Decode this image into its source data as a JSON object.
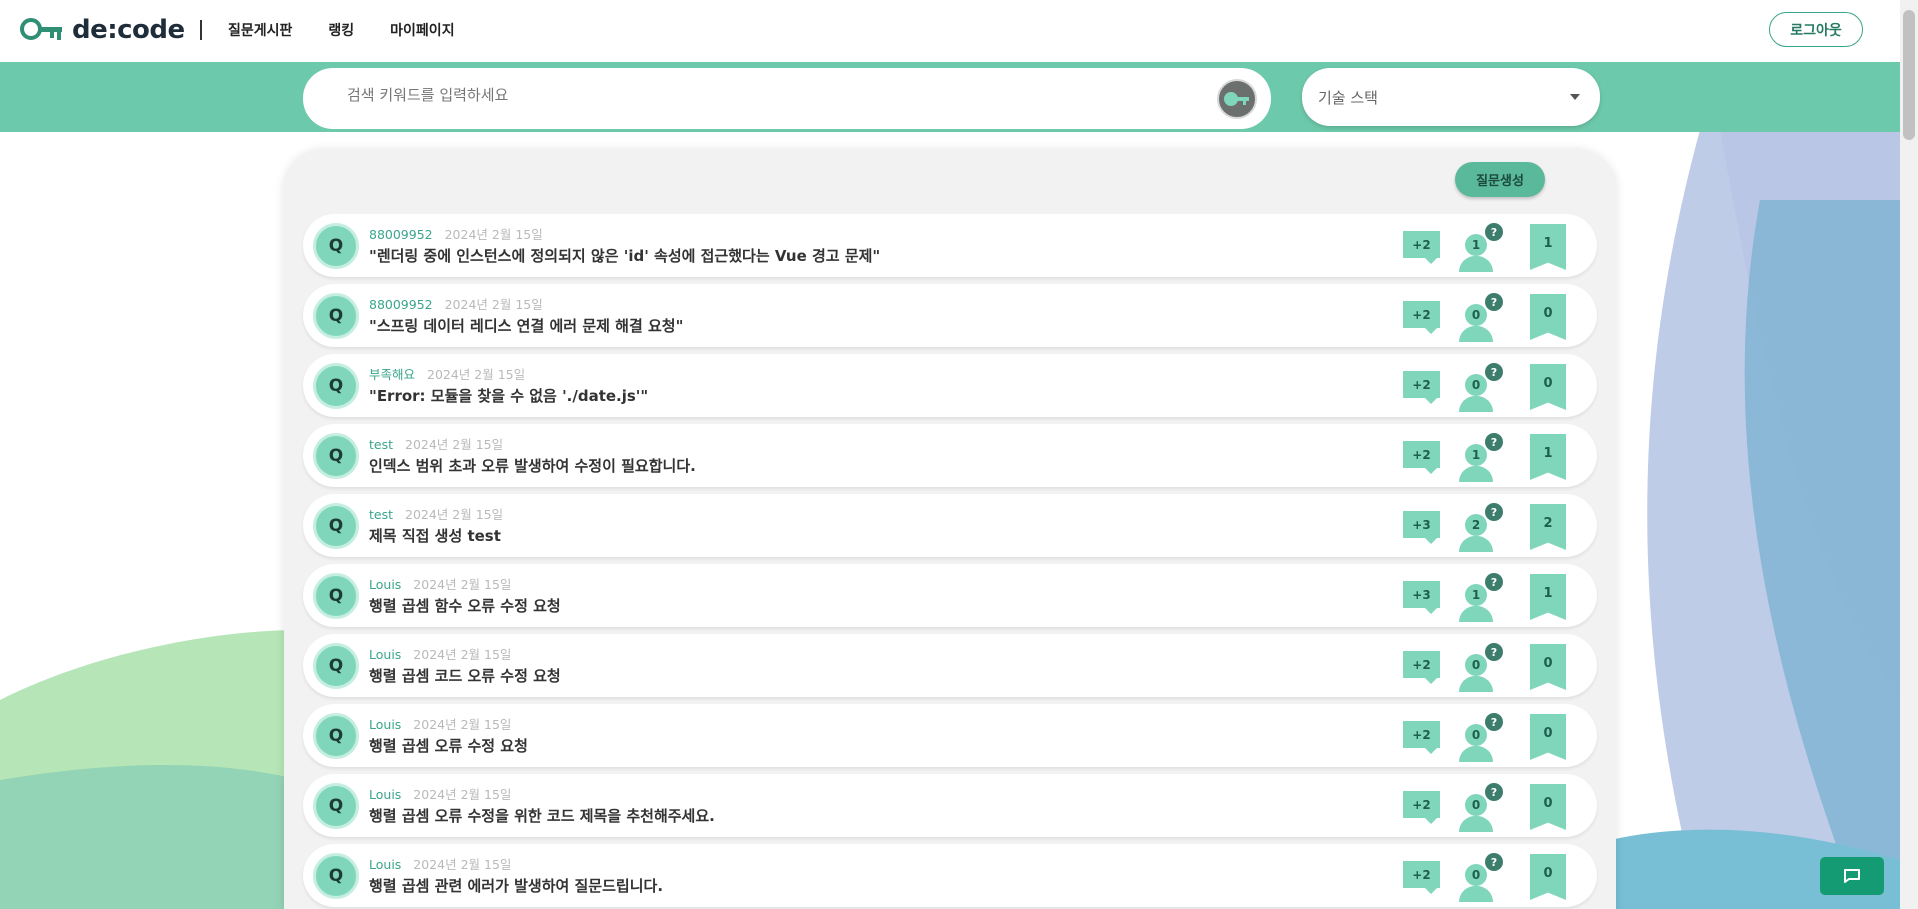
{
  "header": {
    "logo_text": "de:code",
    "nav": [
      "질문게시판",
      "랭킹",
      "마이페이지"
    ],
    "logout_label": "로그아웃"
  },
  "search": {
    "placeholder": "검색 키워드를 입력하세요",
    "tech_stack_label": "기술 스택"
  },
  "panel": {
    "create_label": "질문생성"
  },
  "questions": [
    {
      "avatar": "Q",
      "author": "88009952",
      "date": "2024년 2월 15일",
      "title": "\"렌더링 중에 인스턴스에 정의되지 않은 'id' 속성에 접근했다는 Vue 경고 문제\"",
      "points": "+2",
      "answers": "1",
      "bookmarks": "1"
    },
    {
      "avatar": "Q",
      "author": "88009952",
      "date": "2024년 2월 15일",
      "title": "\"스프링 데이터 레디스 연결 에러 문제 해결 요청\"",
      "points": "+2",
      "answers": "0",
      "bookmarks": "0"
    },
    {
      "avatar": "Q",
      "author": "부족해요",
      "date": "2024년 2월 15일",
      "title": "\"Error: 모듈을 찾을 수 없음 './date.js'\"",
      "points": "+2",
      "answers": "0",
      "bookmarks": "0"
    },
    {
      "avatar": "Q",
      "author": "test",
      "date": "2024년 2월 15일",
      "title": "인덱스 범위 초과 오류 발생하여 수정이 필요합니다.",
      "points": "+2",
      "answers": "1",
      "bookmarks": "1"
    },
    {
      "avatar": "Q",
      "author": "test",
      "date": "2024년 2월 15일",
      "title": "제목 직접 생성 test",
      "points": "+3",
      "answers": "2",
      "bookmarks": "2"
    },
    {
      "avatar": "Q",
      "author": "Louis",
      "date": "2024년 2월 15일",
      "title": "행렬 곱셈 함수 오류 수정 요청",
      "points": "+3",
      "answers": "1",
      "bookmarks": "1"
    },
    {
      "avatar": "Q",
      "author": "Louis",
      "date": "2024년 2월 15일",
      "title": "행렬 곱셈 코드 오류 수정 요청",
      "points": "+2",
      "answers": "0",
      "bookmarks": "0"
    },
    {
      "avatar": "Q",
      "author": "Louis",
      "date": "2024년 2월 15일",
      "title": "행렬 곱셈 오류 수정 요청",
      "points": "+2",
      "answers": "0",
      "bookmarks": "0"
    },
    {
      "avatar": "Q",
      "author": "Louis",
      "date": "2024년 2월 15일",
      "title": "행렬 곱셈 오류 수정을 위한 코드 제목을 추천해주세요.",
      "points": "+2",
      "answers": "0",
      "bookmarks": "0"
    },
    {
      "avatar": "Q",
      "author": "Louis",
      "date": "2024년 2월 15일",
      "title": "행렬 곱셈 관련 에러가 발생하여 질문드립니다.",
      "points": "+2",
      "answers": "0",
      "bookmarks": "0"
    }
  ],
  "icons": {
    "search": "key-icon",
    "chat": "chat-bubble-icon",
    "answer": "person-question-icon",
    "bookmark": "bookmark-icon"
  },
  "colors": {
    "accent": "#6dc9ab",
    "accent_dark": "#159b74",
    "author": "#3aa58a"
  }
}
